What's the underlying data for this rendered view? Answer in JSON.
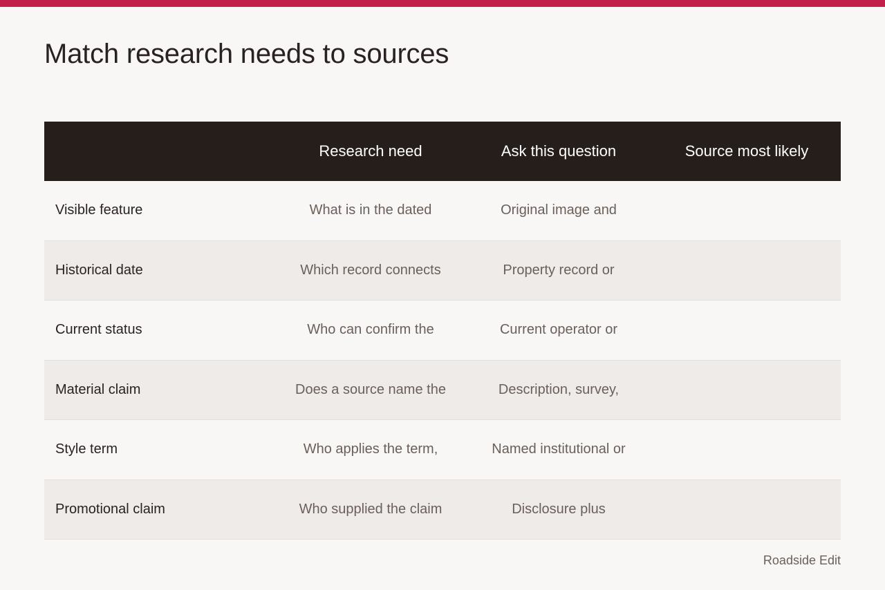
{
  "colors": {
    "accent": "#c0204a",
    "header_bg": "#261e1b",
    "row_alt_bg": "#efebe9",
    "page_bg": "#f8f7f5"
  },
  "page": {
    "title": "Match research needs to sources"
  },
  "table": {
    "headers": [
      "",
      "Research need",
      "Ask this question",
      "Source most likely"
    ],
    "rows": [
      {
        "label": "Visible feature",
        "need": "What is in the dated",
        "question": "Original image and",
        "source": ""
      },
      {
        "label": "Historical date",
        "need": "Which record connects",
        "question": "Property record or",
        "source": ""
      },
      {
        "label": "Current status",
        "need": "Who can confirm the",
        "question": "Current operator or",
        "source": ""
      },
      {
        "label": "Material claim",
        "need": "Does a source name the",
        "question": "Description, survey,",
        "source": ""
      },
      {
        "label": "Style term",
        "need": "Who applies the term,",
        "question": "Named institutional or",
        "source": ""
      },
      {
        "label": "Promotional claim",
        "need": "Who supplied the claim",
        "question": "Disclosure plus",
        "source": ""
      }
    ]
  },
  "footer": {
    "brand": "Roadside Edit"
  }
}
